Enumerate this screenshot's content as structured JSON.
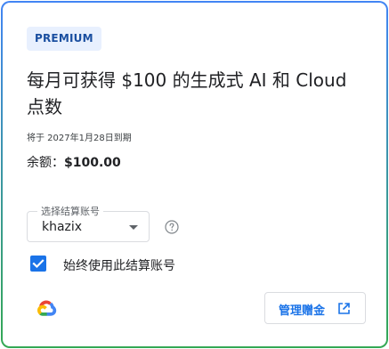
{
  "badge": "PREMIUM",
  "title": "每月可获得 $100 的生成式 AI 和 Cloud 点数",
  "expiry": "将于 2027年1月28日到期",
  "balance": {
    "label": "余额：",
    "amount": "$100.00"
  },
  "billing": {
    "field_label": "选择结算账号",
    "selected": "khazix"
  },
  "always_use": {
    "label": "始终使用此结算账号",
    "checked": true
  },
  "manage_button": {
    "label": "管理赠金"
  },
  "icons": {
    "help": "help-circle-icon",
    "open_external": "open-in-new-icon",
    "logo": "google-cloud-logo"
  },
  "colors": {
    "accent": "#1a73e8",
    "badge_bg": "#e8f0fe",
    "frame_top": "#4285f4",
    "frame_bottom": "#34a853"
  }
}
